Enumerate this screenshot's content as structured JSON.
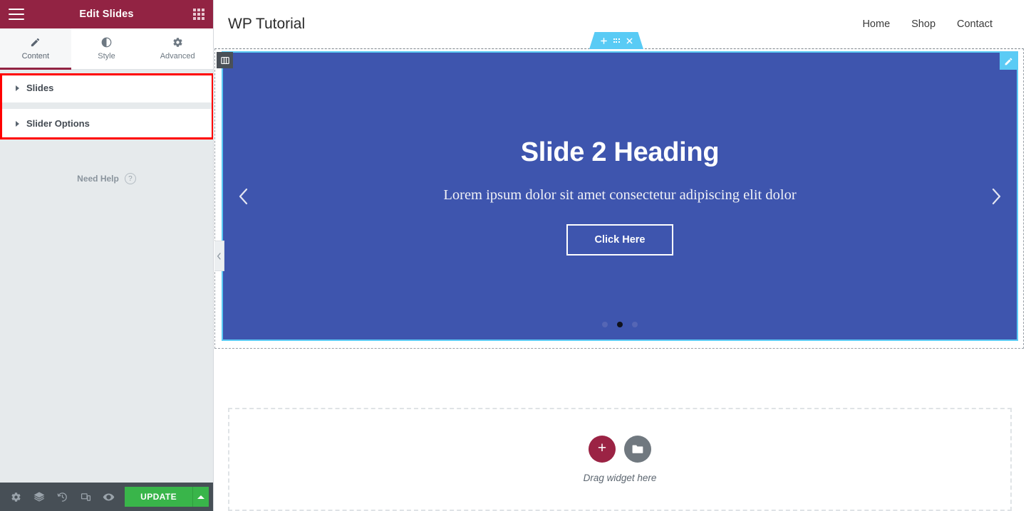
{
  "panel": {
    "header": {
      "title": "Edit Slides",
      "menu_icon": "hamburger-icon",
      "apps_icon": "grid-apps-icon"
    },
    "tabs": [
      {
        "label": "Content",
        "icon": "pencil-icon",
        "active": true
      },
      {
        "label": "Style",
        "icon": "contrast-circle-icon",
        "active": false
      },
      {
        "label": "Advanced",
        "icon": "gear-icon",
        "active": false
      }
    ],
    "accordion": [
      {
        "label": "Slides",
        "expanded": false,
        "arrow": "triangle-right-icon"
      },
      {
        "label": "Slider Options",
        "expanded": false,
        "arrow": "triangle-right-icon"
      }
    ],
    "highlight_color": "#ff0000",
    "need_help": {
      "label": "Need Help",
      "icon": "question-circle-icon"
    },
    "footer": {
      "icons": [
        "settings-gear-icon",
        "layers-navigator-icon",
        "history-clock-icon",
        "responsive-mode-icon",
        "preview-eye-icon"
      ],
      "update_label": "UPDATE",
      "update_color": "#39b54a",
      "caret_icon": "caret-up-icon"
    }
  },
  "preview": {
    "site_title": "WP Tutorial",
    "nav": [
      {
        "label": "Home"
      },
      {
        "label": "Shop"
      },
      {
        "label": "Contact"
      }
    ],
    "section_handle": {
      "add_icon": "plus-icon",
      "drag_icon": "six-dots-drag-icon",
      "close_icon": "close-x-icon",
      "color": "#59cbf5"
    },
    "column_handle_icon": "column-edit-icon",
    "slide": {
      "edit_icon": "pencil-edit-icon",
      "background_color": "#3e55ae",
      "border_color": "#5bcbf5",
      "heading": "Slide 2 Heading",
      "text": "Lorem ipsum dolor sit amet consectetur adipiscing elit dolor",
      "button_label": "Click Here",
      "prev_icon": "chevron-left-icon",
      "next_icon": "chevron-right-icon",
      "dots": [
        {
          "active": false
        },
        {
          "active": true
        },
        {
          "active": false
        }
      ]
    },
    "drop_area": {
      "add_icon": "plus-icon",
      "folder_icon": "folder-template-icon",
      "label": "Drag widget here"
    },
    "collapse_tab_icon": "chevron-left-icon"
  }
}
